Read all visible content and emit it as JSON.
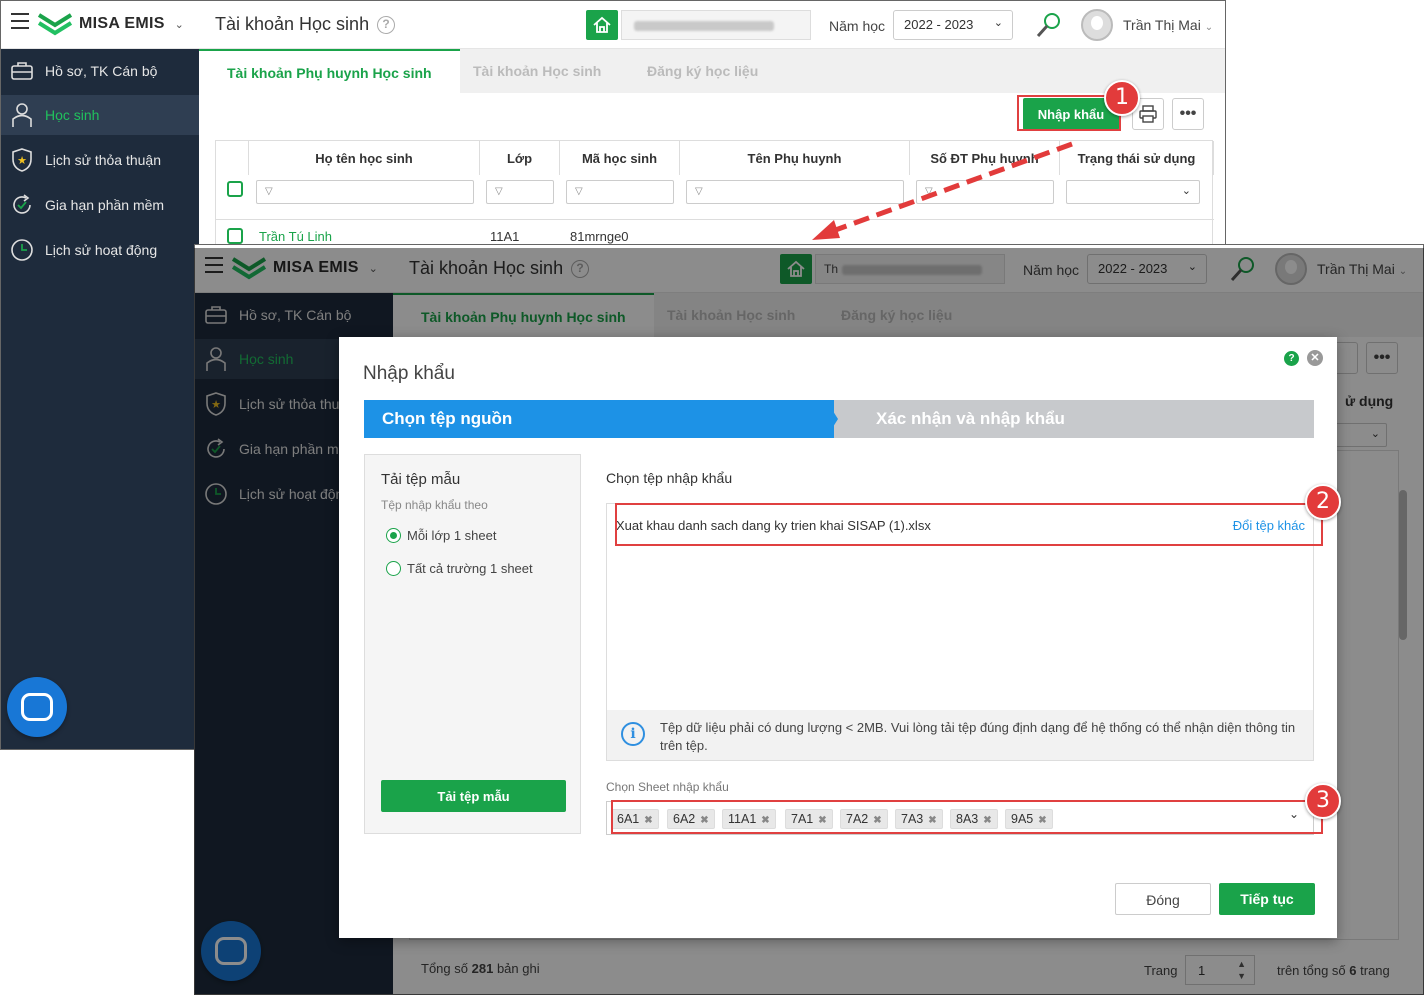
{
  "app": {
    "brand": "MISA EMIS",
    "page_title": "Tài khoản Học sinh",
    "school_prefix": "Th",
    "year_label": "Năm học",
    "year_value": "2022 - 2023",
    "user_name": "Trần Thị Mai",
    "accent_color": "#1aa34a"
  },
  "sidebar": {
    "items": [
      {
        "label": "Hồ sơ, TK Cán bộ",
        "icon": "briefcase-icon"
      },
      {
        "label": "Học sinh",
        "icon": "student-icon",
        "active": true
      },
      {
        "label": "Lịch sử thỏa thuận",
        "icon": "shield-star-icon"
      },
      {
        "label": "Gia hạn phần mềm",
        "icon": "renew-icon"
      },
      {
        "label": "Lịch sử hoạt động",
        "icon": "clock-icon"
      }
    ],
    "back_items_truncated": [
      "Lịch sử thỏa thuậ",
      "Gia hạn phần mề",
      "Lịch sử hoạt độn"
    ]
  },
  "tabs": [
    "Tài khoản Phụ huynh Học sinh",
    "Tài khoản Học sinh",
    "Đăng ký học liệu"
  ],
  "toolbar": {
    "import_label": "Nhập khẩu"
  },
  "grid": {
    "columns": [
      "Họ tên học sinh",
      "Lớp",
      "Mã học sinh",
      "Tên Phụ huynh",
      "Số ĐT Phụ huynh",
      "Trạng thái sử dụng"
    ],
    "rows": [
      {
        "name": "Trần Tú Linh",
        "class": "11A1",
        "code": "81mrnge0"
      }
    ],
    "back_status_header_truncated": "ử dụng"
  },
  "footer": {
    "total_prefix": "Tổng số",
    "total": "281",
    "total_suffix": "bản ghi",
    "page_label": "Trang",
    "page_value": "1",
    "pages_prefix": "trên tổng số",
    "pages": "6",
    "pages_suffix": "trang"
  },
  "dialog": {
    "title": "Nhập khẩu",
    "step1": "Chọn tệp nguồn",
    "step2": "Xác nhận và nhập khẩu",
    "template": {
      "heading": "Tải tệp mẫu",
      "subheading": "Tệp nhập khẩu theo",
      "option1": "Mỗi lớp 1 sheet",
      "option2": "Tất cả trường 1 sheet",
      "selected": "option1",
      "button": "Tải tệp mẫu"
    },
    "file": {
      "heading": "Chọn tệp nhập khẩu",
      "name": "Xuat khau danh sach dang ky trien khai SISAP (1).xlsx",
      "change_link": "Đổi tệp khác",
      "info": "Tệp dữ liệu phải có dung lượng < 2MB. Vui lòng tải tệp đúng định dạng để hệ thống có thể nhận diện thông tin trên tệp."
    },
    "sheet": {
      "label": "Chọn Sheet nhập khẩu",
      "chips": [
        "6A1",
        "6A2",
        "11A1",
        "7A1",
        "7A2",
        "7A3",
        "8A3",
        "9A5"
      ]
    },
    "buttons": {
      "close": "Đóng",
      "next": "Tiếp tục"
    }
  },
  "annotations": [
    "1",
    "2",
    "3"
  ]
}
